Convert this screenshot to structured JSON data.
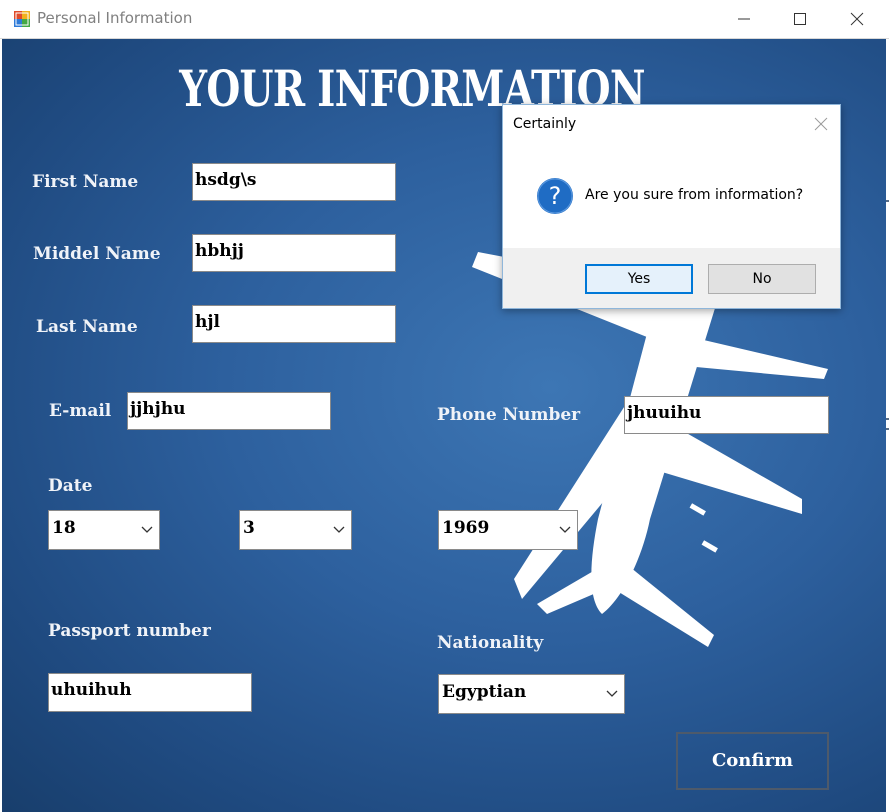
{
  "window": {
    "title": "Personal Information"
  },
  "form": {
    "heading": "YOUR INFORMATION",
    "first_name_label": "First Name",
    "first_name_value": "hsdg\\s",
    "middle_name_label": "Middel Name",
    "middle_name_value": "hbhjj",
    "last_name_label": "Last Name",
    "last_name_value": "hjl",
    "email_label": "E-mail",
    "email_value": "jjhjhu",
    "phone_label": "Phone Number",
    "phone_value": "jhuuihu",
    "date_label": "Date",
    "day_value": "18",
    "month_value": "3",
    "year_value": "1969",
    "passport_label": "Passport number",
    "passport_value": "uhuihuh",
    "nationality_label": "Nationality",
    "nationality_value": "Egyptian",
    "confirm_label": "Confirm"
  },
  "dialog": {
    "title": "Certainly",
    "message": "Are you sure from information?",
    "yes_label": "Yes",
    "no_label": "No"
  },
  "icons": {
    "app": "app-icon",
    "minimize": "minimize-icon",
    "maximize": "maximize-icon",
    "close": "close-icon",
    "question": "question-icon",
    "dropdown": "chevron-down-icon",
    "background": "airplane-illustration"
  },
  "colors": {
    "background_blue": "#2d609e",
    "dialog_accent": "#0078d7",
    "question_icon": "#1f6cc4"
  }
}
